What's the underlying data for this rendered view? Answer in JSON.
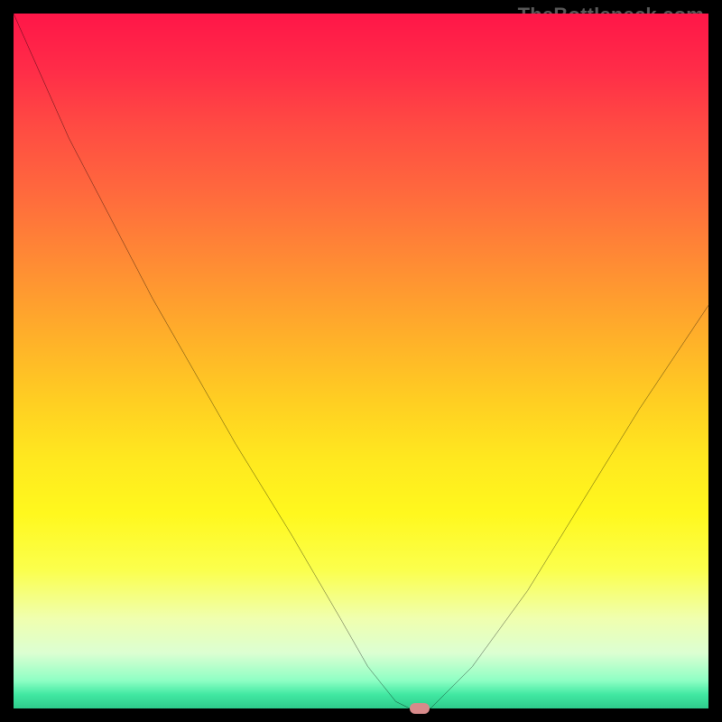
{
  "watermark": {
    "text": "TheBottleneck.com"
  },
  "colors": {
    "marker": "#d88a8a",
    "curve": "#000000"
  },
  "chart_data": {
    "type": "line",
    "title": "",
    "xlabel": "",
    "ylabel": "",
    "xlim": [
      0,
      100
    ],
    "ylim": [
      0,
      100
    ],
    "grid": false,
    "legend": false,
    "series": [
      {
        "name": "bottleneck-curve",
        "x": [
          0,
          8,
          20,
          32,
          40,
          47,
          51,
          55,
          57,
          60,
          66,
          74,
          82,
          90,
          100
        ],
        "y": [
          100,
          82,
          59,
          38,
          25,
          13,
          6,
          1,
          0,
          0,
          6,
          17,
          30,
          43,
          58
        ]
      }
    ],
    "marker": {
      "x": 58.5,
      "y": 0
    },
    "background_gradient": {
      "top_color": "#ff1648",
      "bottom_color": "#2ecc8c"
    }
  }
}
